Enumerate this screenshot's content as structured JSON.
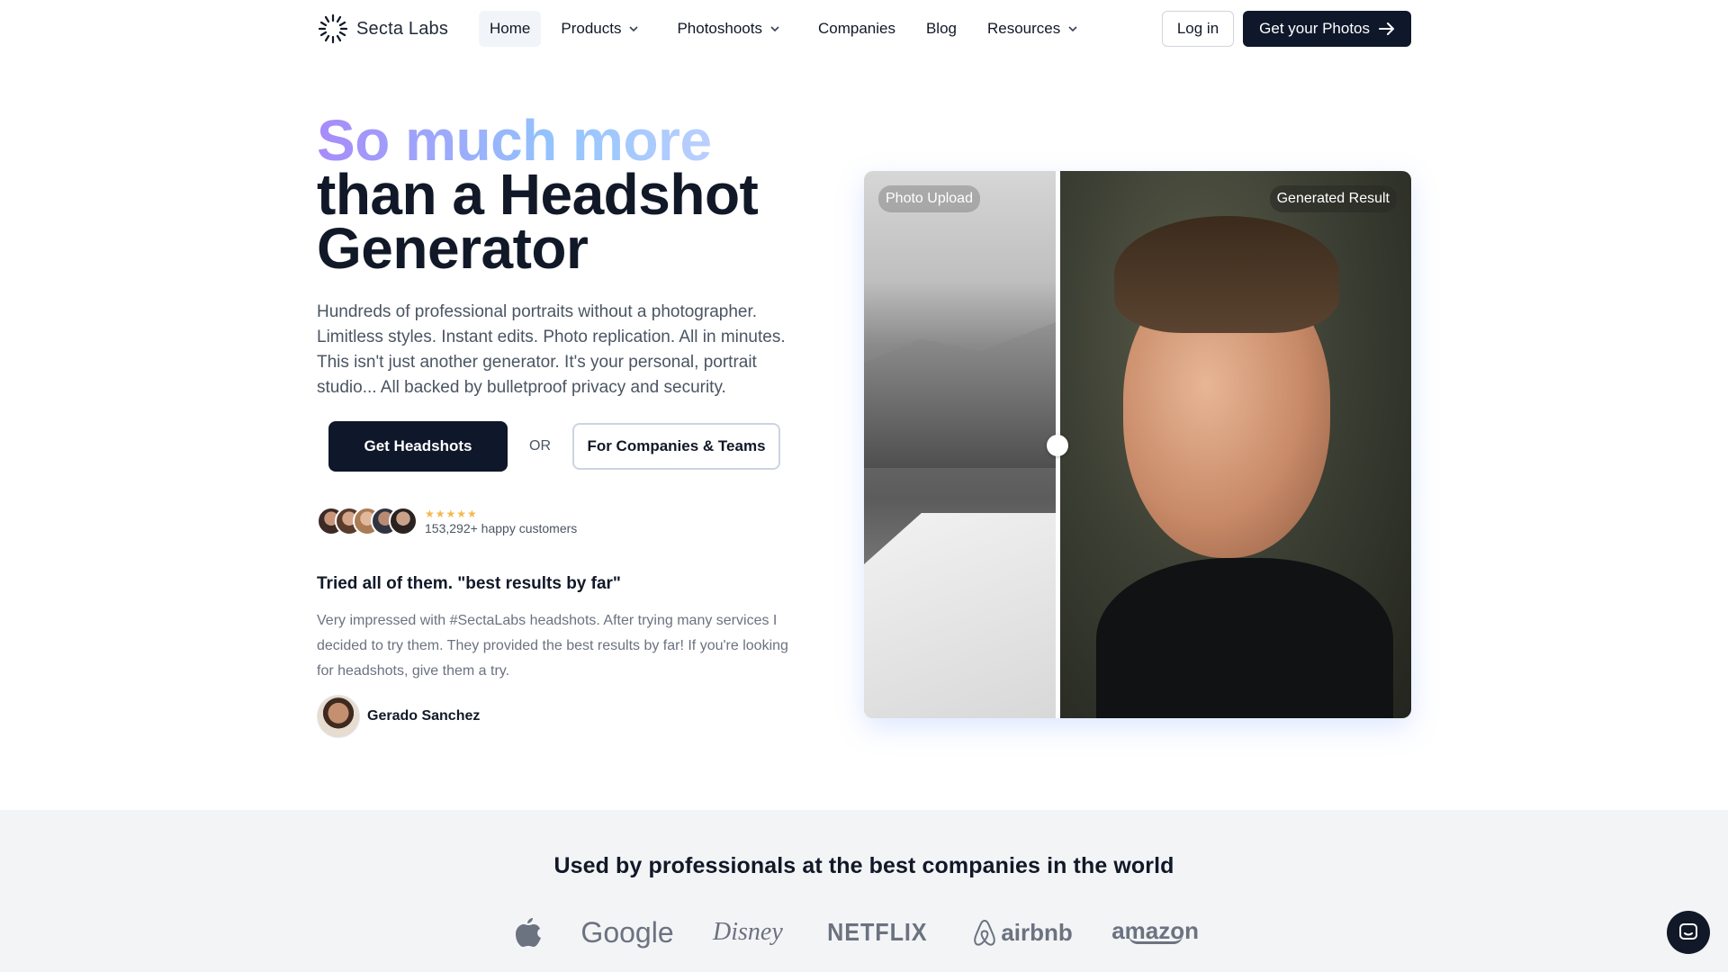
{
  "nav": {
    "brand": "Secta Labs",
    "links": [
      {
        "label": "Home"
      },
      {
        "label": "Products"
      },
      {
        "label": "Photoshoots"
      },
      {
        "label": "Companies"
      },
      {
        "label": "Blog"
      },
      {
        "label": "Resources"
      }
    ],
    "login": "Log in",
    "cta": "Get your Photos"
  },
  "hero": {
    "title_line1": "So much more",
    "title_line2": "than a Headshot",
    "title_line3": "Generator",
    "description": "Hundreds of professional portraits without a photographer. Limitless styles. Instant edits. Photo replication. All in minutes. This isn't just another generator. It's your personal, portrait studio... All backed by bulletproof privacy and security.",
    "primary_button": "Get Headshots",
    "or": "OR",
    "secondary_button": "For Companies & Teams",
    "stars": "★★★★★",
    "customers": "153,292+ happy customers"
  },
  "testimonial": {
    "title": "Tried all of them. \"best results by far\"",
    "body": "Very impressed with #SectaLabs headshots. After trying many services I decided to try them. They provided the best results by far! If you're looking for headshots, give them a try.",
    "author": "Gerado Sanchez"
  },
  "compare": {
    "left_label": "Photo Upload",
    "right_label": "Generated Result"
  },
  "band": {
    "title": "Used by professionals at the best companies in the world",
    "logos": {
      "google": "Google",
      "disney": "Disney",
      "netflix": "NETFLIX",
      "airbnb": "airbnb",
      "amazon": "amazon"
    }
  },
  "colors": {
    "primary": "#0f172a",
    "gradient_start": "#a78bfa",
    "gradient_end": "#93c5fd",
    "band_bg": "#f3f4f6"
  }
}
